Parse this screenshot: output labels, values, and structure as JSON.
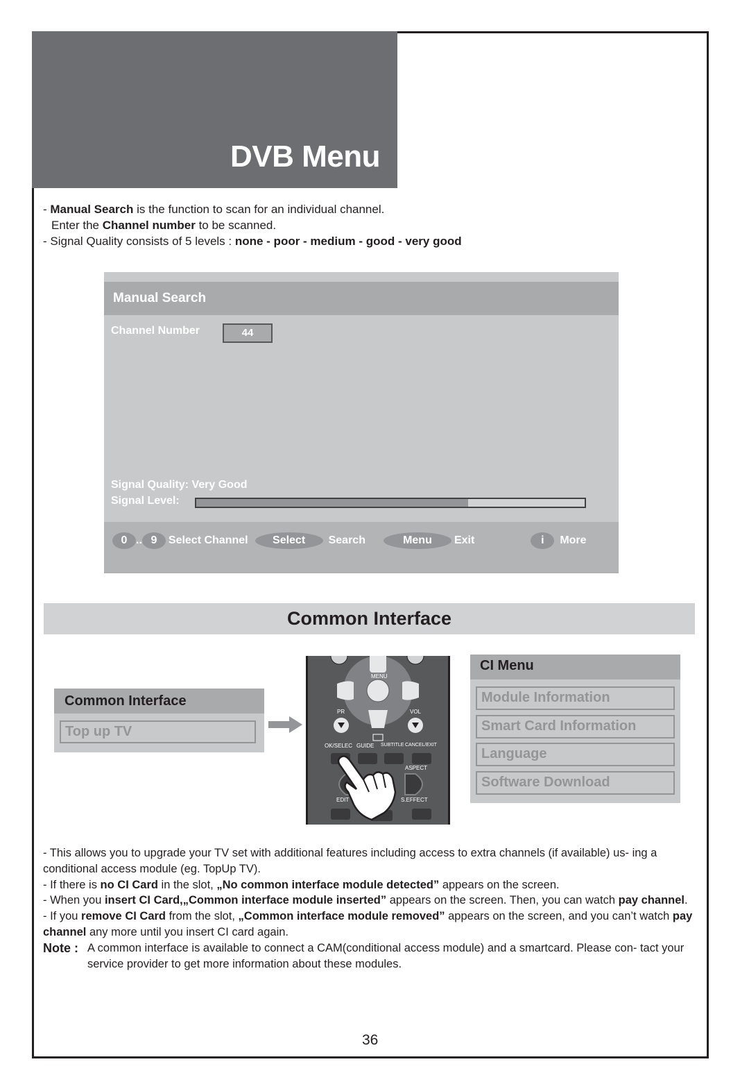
{
  "page": {
    "title": "DVB Menu",
    "page_number": "36"
  },
  "intro": {
    "line1": {
      "bold": "Manual Search",
      "rest": " is the function to scan for an individual channel."
    },
    "line2": {
      "pre": "Enter the ",
      "bold": "Channel number",
      "rest": " to be scanned."
    },
    "line3": {
      "pre": "- Signal Quality consists of 5 levels : ",
      "bold": "none - poor - medium - good - very good"
    }
  },
  "manual_search": {
    "header": "Manual Search",
    "channel_label": "Channel Number",
    "channel_value": "44",
    "signal_quality": "Signal Quality: Very Good",
    "signal_level_label": "Signal Level:",
    "signal_level_percent": 70,
    "footer": {
      "key_0": "0",
      "dots": "..",
      "key_9": "9",
      "select_channel": "Select Channel",
      "select_key": "Select",
      "search": "Search",
      "menu_key": "Menu",
      "exit": "Exit",
      "info_key": "i",
      "more": "More"
    }
  },
  "common_interface": {
    "section_title": "Common Interface",
    "menu_small": {
      "header": "Common Interface",
      "item": "Top up TV"
    },
    "remote_labels": [
      "MENU",
      "PR",
      "VOL",
      "OK/SELEC",
      "GUIDE",
      "SUBTITLE",
      "CANCEL/EXIT",
      "ASPECT",
      "EDIT",
      "S.EFFECT"
    ],
    "ci_menu": {
      "header": "CI Menu",
      "items": [
        "Module Information",
        "Smart Card Information",
        "Language",
        "Software Download"
      ]
    }
  },
  "notes": {
    "p1": "- This allows you to upgrade your TV set with additional features including access to extra channels (if available) us- ing a conditional access module (eg. TopUp TV).",
    "p2": {
      "pre": "- If there is ",
      "b1": "no CI Card",
      "mid": " in the slot, ",
      "b2": "„No common interface module detected”",
      "post": " appears on the screen."
    },
    "p3": {
      "pre": "- When you ",
      "b1": "insert CI Card,„Common interface module inserted”",
      "mid": " appears on the screen. Then, you can watch ",
      "b2": "pay channel",
      "post": "."
    },
    "p4": {
      "pre": "- If you ",
      "b1": "remove CI Card",
      "mid": " from the slot, ",
      "b2": "„Common interface module removed”",
      "mid2": " appears on the screen, and you can’t watch ",
      "b3": "pay channel",
      "post": " any more until you insert CI card again."
    },
    "note_lead": "Note :",
    "note_text": "A common interface is available to connect a CAM(conditional access module) and a smartcard. Please con- tact your service provider to get more information about these modules."
  }
}
